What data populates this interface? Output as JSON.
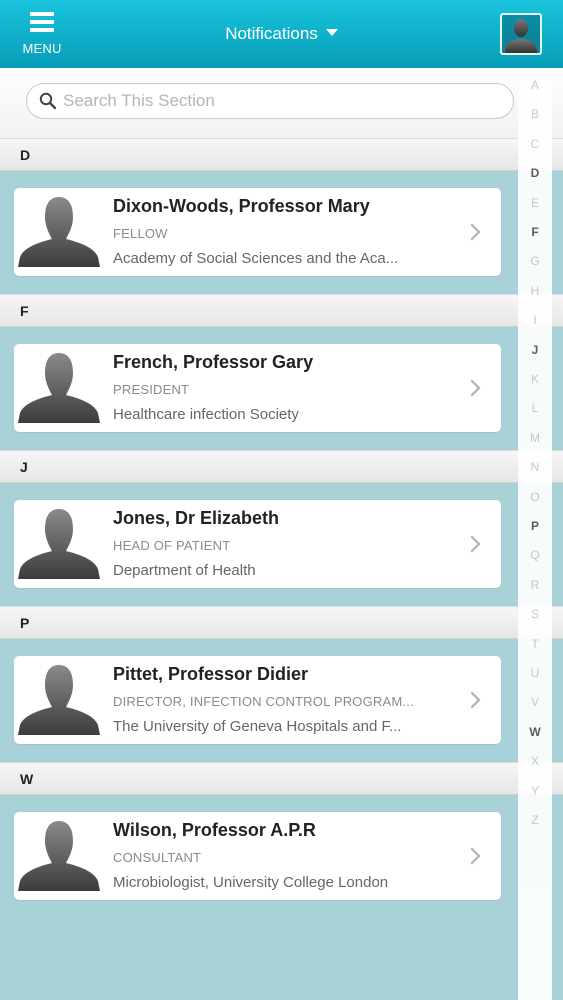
{
  "header": {
    "menu_label": "MENU",
    "title": "Notifications"
  },
  "search": {
    "placeholder": "Search This Section"
  },
  "sections": [
    {
      "letter": "D",
      "name": "Dixon-Woods, Professor Mary",
      "role": "FELLOW",
      "org": "Academy of Social Sciences and the Aca..."
    },
    {
      "letter": "F",
      "name": "French, Professor Gary",
      "role": "PRESIDENT",
      "org": "Healthcare infection Society"
    },
    {
      "letter": "J",
      "name": "Jones, Dr Elizabeth",
      "role": "HEAD OF PATIENT",
      "org": "Department of Health"
    },
    {
      "letter": "P",
      "name": "Pittet, Professor Didier",
      "role": "DIRECTOR, INFECTION CONTROL PROGRAM...",
      "org": "The University of Geneva Hospitals and F..."
    },
    {
      "letter": "W",
      "name": "Wilson, Professor A.P.R",
      "role": "CONSULTANT",
      "org": "Microbiologist, University College London"
    }
  ],
  "index": [
    "A",
    "B",
    "C",
    "D",
    "E",
    "F",
    "G",
    "H",
    "I",
    "J",
    "K",
    "L",
    "M",
    "N",
    "O",
    "P",
    "Q",
    "R",
    "S",
    "T",
    "U",
    "V",
    "W",
    "X",
    "Y",
    "Z"
  ],
  "index_active": [
    "D",
    "F",
    "J",
    "P",
    "W"
  ],
  "colors": {
    "header_top": "#19c4dc",
    "header_bottom": "#079db7",
    "list_background": "#a9d2d8"
  }
}
